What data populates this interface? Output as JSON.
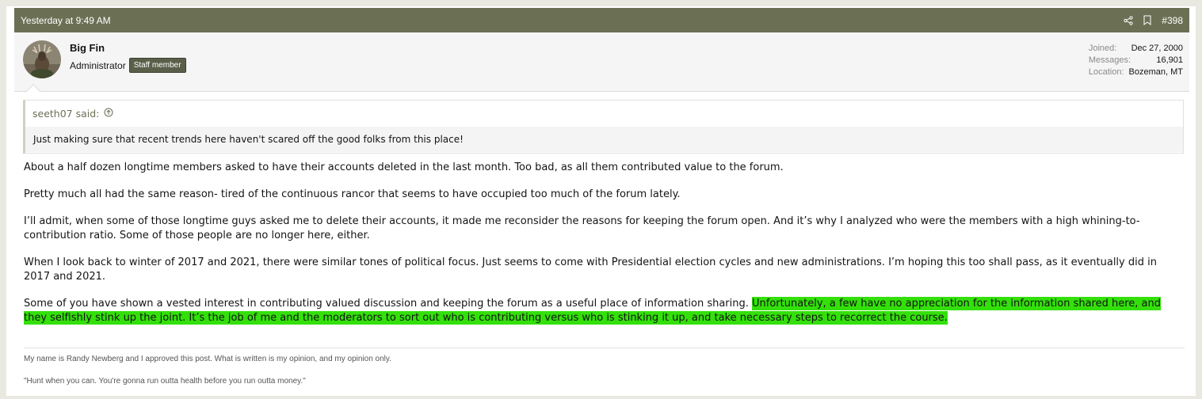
{
  "post": {
    "date": "Yesterday at 9:49 AM",
    "number": "#398",
    "icons": [
      "share-icon",
      "bookmark-icon"
    ]
  },
  "user": {
    "name": "Big Fin",
    "title": "Administrator",
    "badge": "Staff member",
    "stats": {
      "joined_label": "Joined:",
      "joined": "Dec 27, 2000",
      "messages_label": "Messages:",
      "messages": "16,901",
      "location_label": "Location:",
      "location": "Bozeman, MT"
    }
  },
  "quote": {
    "author": "seeth07 said:",
    "text": "Just making sure that recent trends here haven't scared off the good folks from this place!"
  },
  "message": {
    "p1": "About a half dozen longtime members asked to have their accounts deleted in the last month. Too bad, as all them contributed value to the forum.",
    "p2": "Pretty much all had the same reason- tired of the continuous rancor that seems to have occupied too much of the forum lately.",
    "p3": "I’ll admit, when some of those longtime guys asked me to delete their accounts, it made me reconsider the reasons for keeping the forum open. And it’s why I analyzed who were the members with a high whining-to-contribution ratio. Some of those people are no longer here, either.",
    "p4": "When I look back to winter of 2017 and 2021, there were similar tones of political focus. Just seems to come with Presidential election cycles and new administrations. I’m hoping this too shall pass, as it eventually did in 2017 and 2021.",
    "p5_plain": "Some of you have shown a vested interest in contributing valued discussion and keeping the forum as a useful place of information sharing. ",
    "p5_highlight": "Unfortunately, a few have no appreciation for the information shared here, and they selfishly stink up the joint. It’s the job of me and the moderators to sort out who is contributing versus who is stinking it up, and take necessary steps to recorrect the course.",
    "highlight_color": "#33e00a"
  },
  "signature": {
    "line1": "My name is Randy Newberg and I approved this post. What is written is my opinion, and my opinion only.",
    "line2": "\"Hunt when you can. You're gonna run outta health before you run outta money.\""
  },
  "colors": {
    "header_bg": "#6b7055",
    "page_bg": "#e9e9e1",
    "badge_bg": "#5a5f49"
  }
}
